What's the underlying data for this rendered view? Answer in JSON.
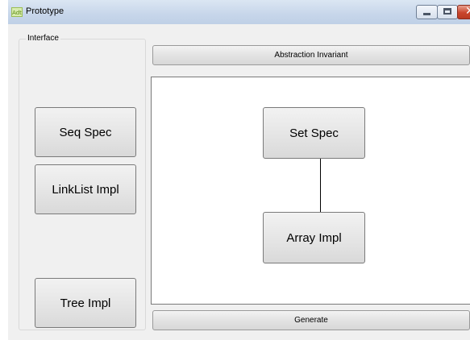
{
  "window": {
    "title": "Prototype",
    "icon_name": "app-icon"
  },
  "sidebar": {
    "group_label": "Interface",
    "buttons": {
      "seq_spec": "Seq Spec",
      "linklist_impl": "LinkList Impl",
      "tree_impl": "Tree Impl"
    }
  },
  "toolbar": {
    "abstraction_invariant": "Abstraction Invariant",
    "generate": "Generate"
  },
  "canvas": {
    "nodes": {
      "set_spec": "Set Spec",
      "array_impl": "Array Impl"
    }
  },
  "colors": {
    "close_button": "#c9452c",
    "titlebar": "#c7d6ea"
  }
}
